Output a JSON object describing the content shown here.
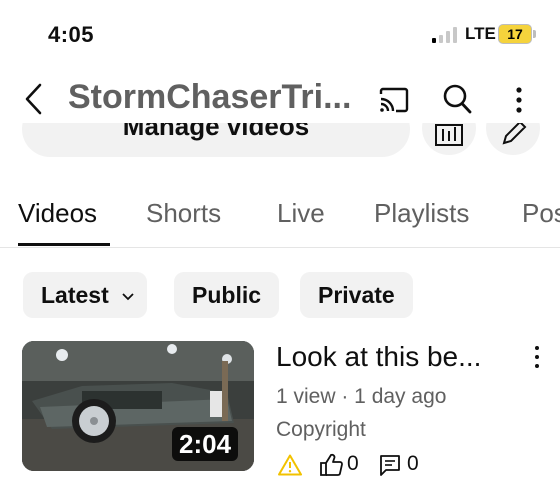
{
  "status_bar": {
    "time": "4:05",
    "network": "LTE",
    "battery": "17"
  },
  "header": {
    "channel_title": "StormChaserTri..."
  },
  "manage": {
    "label": "Manage videos"
  },
  "tabs": [
    {
      "label": "Videos",
      "active": true
    },
    {
      "label": "Shorts"
    },
    {
      "label": "Live"
    },
    {
      "label": "Playlists"
    },
    {
      "label": "Pos"
    }
  ],
  "filters": {
    "sort_label": "Latest",
    "public_label": "Public",
    "private_label": "Private"
  },
  "video": {
    "title": "Look at this be...",
    "meta": "1 view · 1 day ago",
    "visibility": "Copyright",
    "duration": "2:04",
    "likes": "0",
    "comments": "0"
  },
  "icons": {
    "back": "back-arrow-icon",
    "cast": "cast-icon",
    "search": "search-icon",
    "more": "more-vertical-icon",
    "warning": "warning-icon",
    "like": "thumbs-up-icon",
    "comment": "comment-icon"
  },
  "colors": {
    "battery": "#f5d33c",
    "warning": "#f2c200",
    "text_secondary": "#606060"
  }
}
